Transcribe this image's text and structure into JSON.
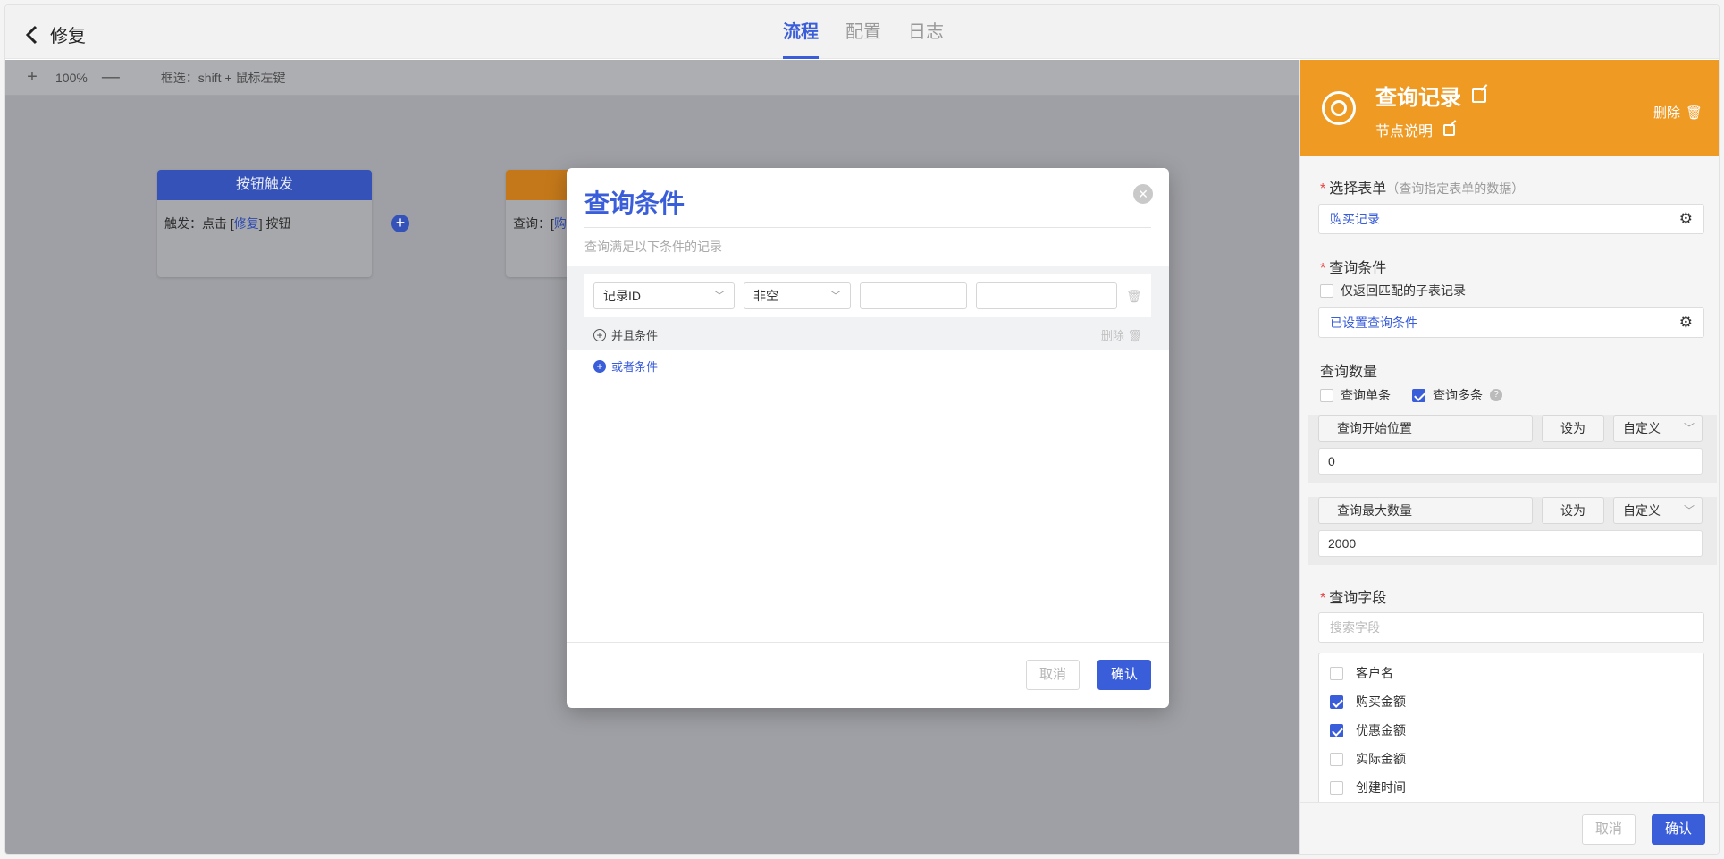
{
  "header": {
    "back_label": "修复",
    "tabs": [
      {
        "label": "流程"
      },
      {
        "label": "配置"
      },
      {
        "label": "日志"
      }
    ]
  },
  "toolbar": {
    "zoom_in": "+",
    "zoom_level": "100%",
    "zoom_out": "—",
    "hint": "框选：shift + 鼠标左键"
  },
  "nodes": {
    "trigger": {
      "title": "按钮触发",
      "prefix": "触发：点击 [",
      "link": "修复",
      "suffix": "] 按钮"
    },
    "query": {
      "prefix": "查询：[",
      "link": "购"
    }
  },
  "modal": {
    "title": "查询条件",
    "subtitle": "查询满足以下条件的记录",
    "condition": {
      "field": "记录ID",
      "operator": "非空"
    },
    "and_label": "并且条件",
    "delete_label": "删除",
    "or_label": "或者条件",
    "cancel": "取消",
    "confirm": "确认"
  },
  "panel": {
    "title": "查询记录",
    "note": "节点说明",
    "delete": "删除",
    "form_label": "选择表单",
    "form_tip": "（查询指定表单的数据）",
    "form_value": "购买记录",
    "cond_label": "查询条件",
    "cond_checkbox": "仅返回匹配的子表记录",
    "cond_value": "已设置查询条件",
    "count_label": "查询数量",
    "single": "查询单条",
    "multi": "查询多条",
    "start": {
      "name": "查询开始位置",
      "set": "设为",
      "mode": "自定义",
      "value": "0"
    },
    "max": {
      "name": "查询最大数量",
      "set": "设为",
      "mode": "自定义",
      "value": "2000"
    },
    "fields_label": "查询字段",
    "search_placeholder": "搜索字段",
    "fields": [
      {
        "name": "客户名",
        "checked": false
      },
      {
        "name": "购买金额",
        "checked": true
      },
      {
        "name": "优惠金额",
        "checked": true
      },
      {
        "name": "实际金额",
        "checked": false
      },
      {
        "name": "创建时间",
        "checked": false
      }
    ],
    "cancel": "取消",
    "confirm": "确认"
  },
  "colors": {
    "accent": "#3a5dd9",
    "panel_header": "#ef9a23"
  }
}
